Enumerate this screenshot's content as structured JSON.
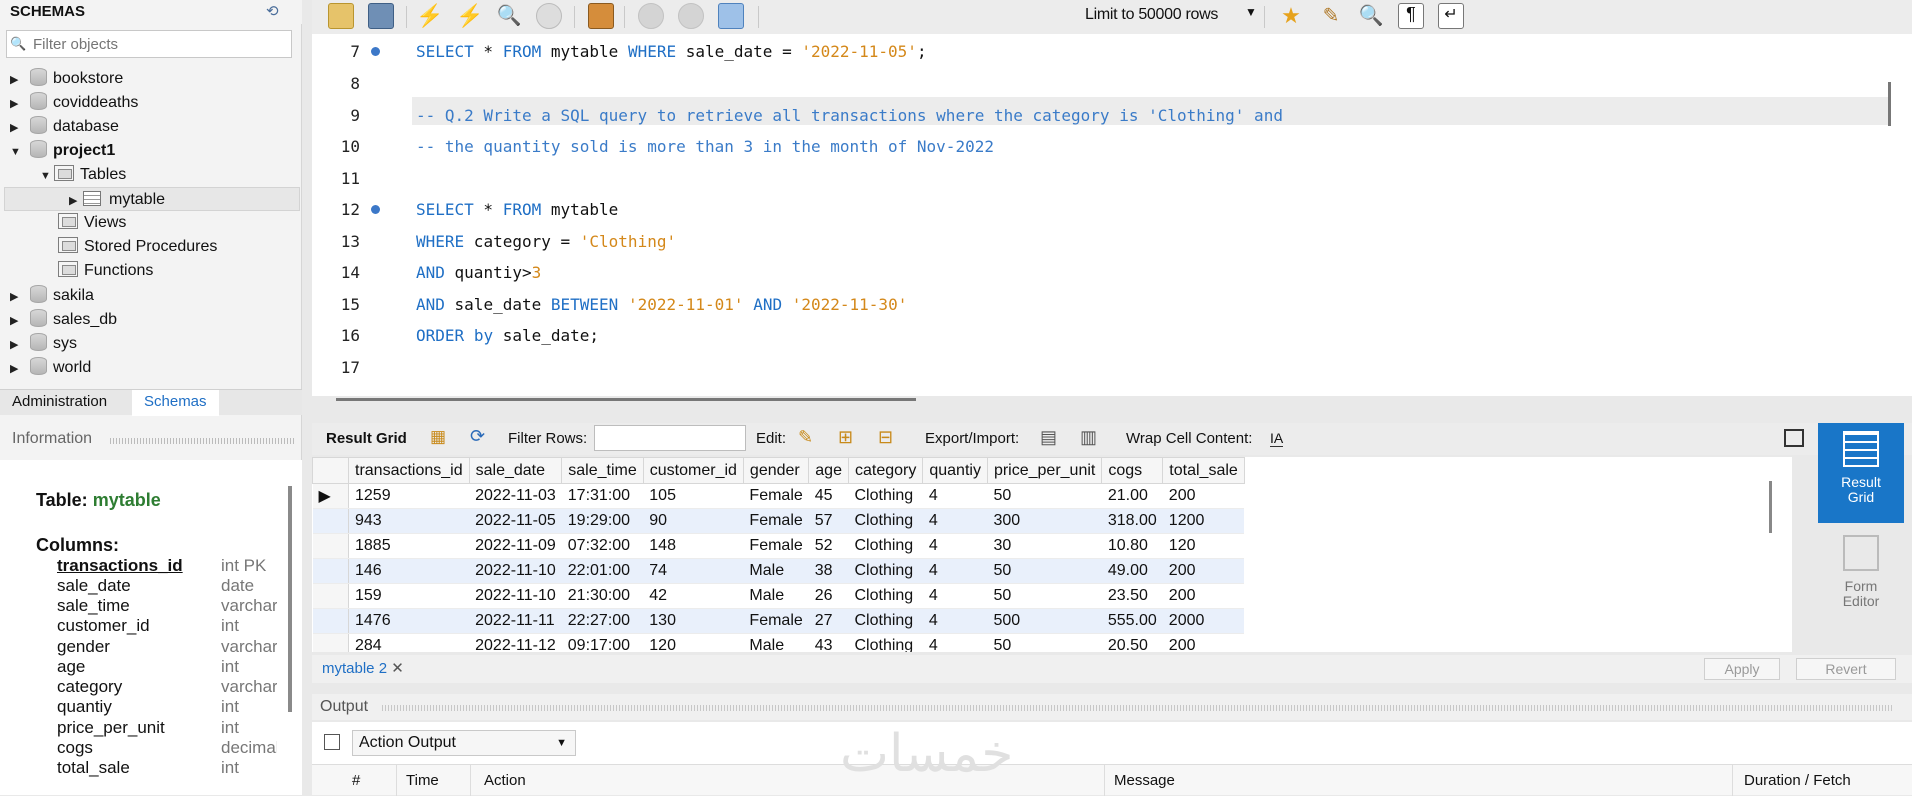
{
  "sidebar": {
    "title": "SCHEMAS",
    "filter_placeholder": "Filter objects",
    "schemas": [
      "bookstore",
      "coviddeaths",
      "database",
      "project1",
      "sakila",
      "sales_db",
      "sys",
      "world"
    ],
    "project1_children": {
      "tables": "Tables",
      "table": "mytable",
      "views": "Views",
      "stored_procedures": "Stored Procedures",
      "functions": "Functions"
    },
    "tabs": [
      "Administration",
      "Schemas"
    ],
    "active_tab": "Schemas"
  },
  "info": {
    "title": "Information",
    "table_label": "Table:",
    "table_name": "mytable",
    "columns_label": "Columns:",
    "columns": [
      {
        "name": "transactions_id",
        "type": "int PK"
      },
      {
        "name": "sale_date",
        "type": "date"
      },
      {
        "name": "sale_time",
        "type": "varchar"
      },
      {
        "name": "customer_id",
        "type": "int"
      },
      {
        "name": "gender",
        "type": "varchar"
      },
      {
        "name": "age",
        "type": "int"
      },
      {
        "name": "category",
        "type": "varchar"
      },
      {
        "name": "quantiy",
        "type": "int"
      },
      {
        "name": "price_per_unit",
        "type": "int"
      },
      {
        "name": "cogs",
        "type": "decimal"
      },
      {
        "name": "total_sale",
        "type": "int"
      }
    ]
  },
  "toolbar": {
    "limit_label": "Limit to 50000 rows"
  },
  "editor": {
    "lines": [
      "7",
      "8",
      "9",
      "10",
      "11",
      "12",
      "13",
      "14",
      "15",
      "16",
      "17"
    ],
    "l7": {
      "a": "SELECT",
      "b": " * ",
      "c": "FROM",
      "d": " mytable ",
      "e": "WHERE",
      "f": " sale_date = ",
      "g": "'2022-11-05'",
      "h": ";"
    },
    "l9": "-- Q.2 Write a SQL query to retrieve all transactions where the category is 'Clothing' and",
    "l10": "-- the quantity sold is more than 3 in the month of Nov-2022",
    "l12": {
      "a": "SELECT",
      "b": " * ",
      "c": "FROM",
      "d": " mytable"
    },
    "l13": {
      "a": "WHERE",
      "b": " category = ",
      "c": "'Clothing'"
    },
    "l14": {
      "a": "AND",
      "b": " quantiy>",
      "c": "3"
    },
    "l15": {
      "a": "AND",
      "b": " sale_date ",
      "c": "BETWEEN",
      "d": " ",
      "e": "'2022-11-01'",
      "f": " ",
      "g": "AND",
      "h": " ",
      "i": "'2022-11-30'"
    },
    "l16": {
      "a": "ORDER",
      "b": " ",
      "c": "by",
      "d": " sale_date;"
    }
  },
  "result_toolbar": {
    "result_grid": "Result Grid",
    "filter_rows": "Filter Rows:",
    "edit": "Edit:",
    "export_import": "Export/Import:",
    "wrap": "Wrap Cell Content:"
  },
  "grid": {
    "columns": [
      "transactions_id",
      "sale_date",
      "sale_time",
      "customer_id",
      "gender",
      "age",
      "category",
      "quantiy",
      "price_per_unit",
      "cogs",
      "total_sale"
    ],
    "rows": [
      [
        "1259",
        "2022-11-03",
        "17:31:00",
        "105",
        "Female",
        "45",
        "Clothing",
        "4",
        "50",
        "21.00",
        "200"
      ],
      [
        "943",
        "2022-11-05",
        "19:29:00",
        "90",
        "Female",
        "57",
        "Clothing",
        "4",
        "300",
        "318.00",
        "1200"
      ],
      [
        "1885",
        "2022-11-09",
        "07:32:00",
        "148",
        "Female",
        "52",
        "Clothing",
        "4",
        "30",
        "10.80",
        "120"
      ],
      [
        "146",
        "2022-11-10",
        "22:01:00",
        "74",
        "Male",
        "38",
        "Clothing",
        "4",
        "50",
        "49.00",
        "200"
      ],
      [
        "159",
        "2022-11-10",
        "21:30:00",
        "42",
        "Male",
        "26",
        "Clothing",
        "4",
        "50",
        "23.50",
        "200"
      ],
      [
        "1476",
        "2022-11-11",
        "22:27:00",
        "130",
        "Female",
        "27",
        "Clothing",
        "4",
        "500",
        "555.00",
        "2000"
      ],
      [
        "284",
        "2022-11-12",
        "09:17:00",
        "120",
        "Male",
        "43",
        "Clothing",
        "4",
        "50",
        "20.50",
        "200"
      ]
    ]
  },
  "side_panel": {
    "result_grid": "Result Grid",
    "form_editor": "Form Editor"
  },
  "bottom": {
    "tab": "mytable 2",
    "apply": "Apply",
    "revert": "Revert"
  },
  "output": {
    "title": "Output",
    "select": "Action Output",
    "columns": [
      "#",
      "Time",
      "Action",
      "Message",
      "Duration / Fetch"
    ]
  },
  "watermark": "خمسات"
}
